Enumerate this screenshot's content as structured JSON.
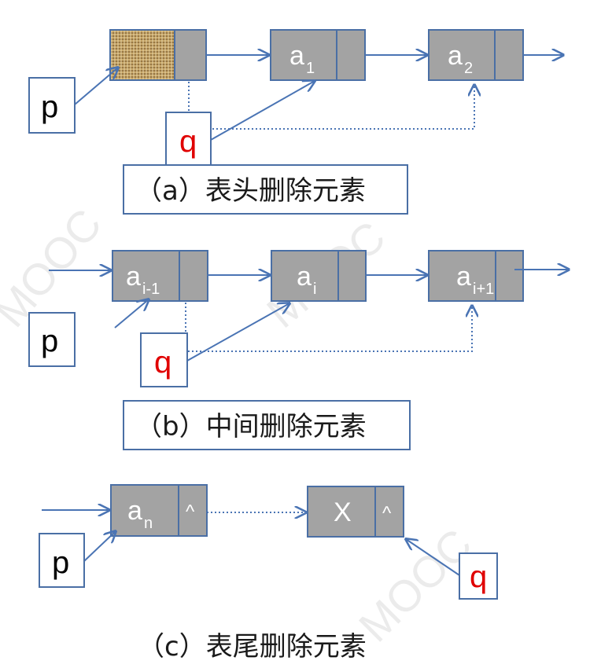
{
  "diagram_a": {
    "caption": "（a）表头删除元素",
    "node1_label": "a",
    "node1_sub": "1",
    "node2_label": "a",
    "node2_sub": "2",
    "p_label": "p",
    "q_label": "q"
  },
  "diagram_b": {
    "caption": "（b）中间删除元素",
    "node1_label": "a",
    "node1_sub": "i-1",
    "node2_label": "a",
    "node2_sub": "i",
    "node3_label": "a",
    "node3_sub": "i+1",
    "p_label": "p",
    "q_label": "q"
  },
  "diagram_c": {
    "caption": "（c）表尾删除元素",
    "node1_label": "a",
    "node1_sub": "n",
    "node1_ptr": "^",
    "node2_label": "X",
    "node2_ptr": "^",
    "p_label": "p",
    "q_label": "q"
  },
  "colors": {
    "node_fill": "#a3a3a3",
    "line": "#4a74b4",
    "q_text": "#e00000"
  }
}
